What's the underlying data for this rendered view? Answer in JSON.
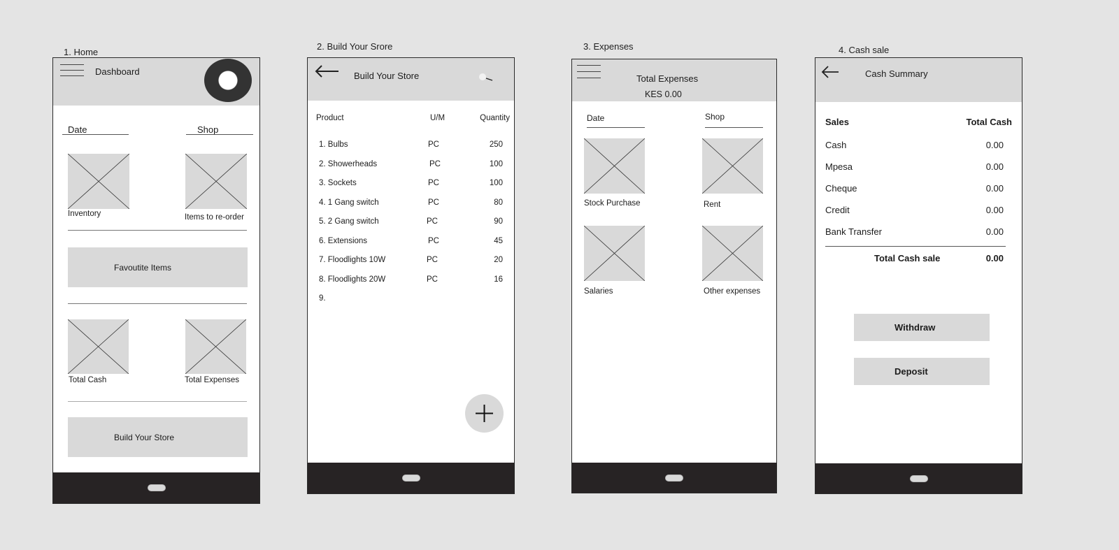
{
  "frames": {
    "home": {
      "label": "1. Home",
      "appbar_title": "Dashboard",
      "filters": {
        "date": "Date",
        "shop": "Shop"
      },
      "tiles_top": [
        {
          "label": "Inventory"
        },
        {
          "label": "Items to re-order"
        }
      ],
      "favourite_button": "Favoutite Items",
      "tiles_bottom": [
        {
          "label": "Total Cash"
        },
        {
          "label": "Total Expenses"
        }
      ],
      "build_store_button": "Build Your Store",
      "icons": {
        "menu": "hamburger-menu-icon",
        "profile": "profile-ring-icon"
      }
    },
    "build_store": {
      "label": "2. Build Your Srore",
      "appbar_title": "Build Your Store",
      "columns": [
        "Product",
        "U/M",
        "Quantity"
      ],
      "rows": [
        {
          "product": "1. Bulbs",
          "um": "PC",
          "qty": "250"
        },
        {
          "product": "2. Showerheads",
          "um": "PC",
          "qty": "100"
        },
        {
          "product": "3. Sockets",
          "um": "PC",
          "qty": "100"
        },
        {
          "product": "4. 1 Gang switch",
          "um": "PC",
          "qty": "80"
        },
        {
          "product": "5. 2 Gang switch",
          "um": "PC",
          "qty": "90"
        },
        {
          "product": "6. Extensions",
          "um": "PC",
          "qty": "45"
        },
        {
          "product": "7. Floodlights 10W",
          "um": "PC",
          "qty": "20"
        },
        {
          "product": "8. Floodlights 20W",
          "um": "PC",
          "qty": "16"
        },
        {
          "product": "9.",
          "um": "",
          "qty": ""
        }
      ],
      "icons": {
        "back": "back-arrow-icon",
        "search": "search-icon",
        "add": "plus-icon"
      }
    },
    "expenses": {
      "label": "3. Expenses",
      "appbar_title": "Total Expenses",
      "appbar_amount": "KES 0.00",
      "filters": {
        "date": "Date",
        "shop": "Shop"
      },
      "tiles": [
        {
          "label": "Stock Purchase"
        },
        {
          "label": "Rent"
        },
        {
          "label": "Salaries"
        },
        {
          "label": "Other expenses"
        }
      ],
      "icons": {
        "menu": "hamburger-menu-icon"
      }
    },
    "cash_sale": {
      "label": "4. Cash sale",
      "appbar_title": "Cash Summary",
      "header": {
        "left": "Sales",
        "right": "Total Cash"
      },
      "rows": [
        {
          "label": "Cash",
          "value": "0.00"
        },
        {
          "label": "Mpesa",
          "value": "0.00"
        },
        {
          "label": "Cheque",
          "value": "0.00"
        },
        {
          "label": "Credit",
          "value": "0.00"
        },
        {
          "label": "Bank Transfer",
          "value": "0.00"
        }
      ],
      "total": {
        "label": "Total  Cash sale",
        "value": "0.00"
      },
      "buttons": {
        "withdraw": "Withdraw",
        "deposit": "Deposit"
      },
      "icons": {
        "back": "back-arrow-icon"
      }
    }
  },
  "colors": {
    "background": "#e4e4e4",
    "placeholder": "#d9d9d9",
    "navbar": "#272324",
    "profile_ring": "#333333"
  }
}
